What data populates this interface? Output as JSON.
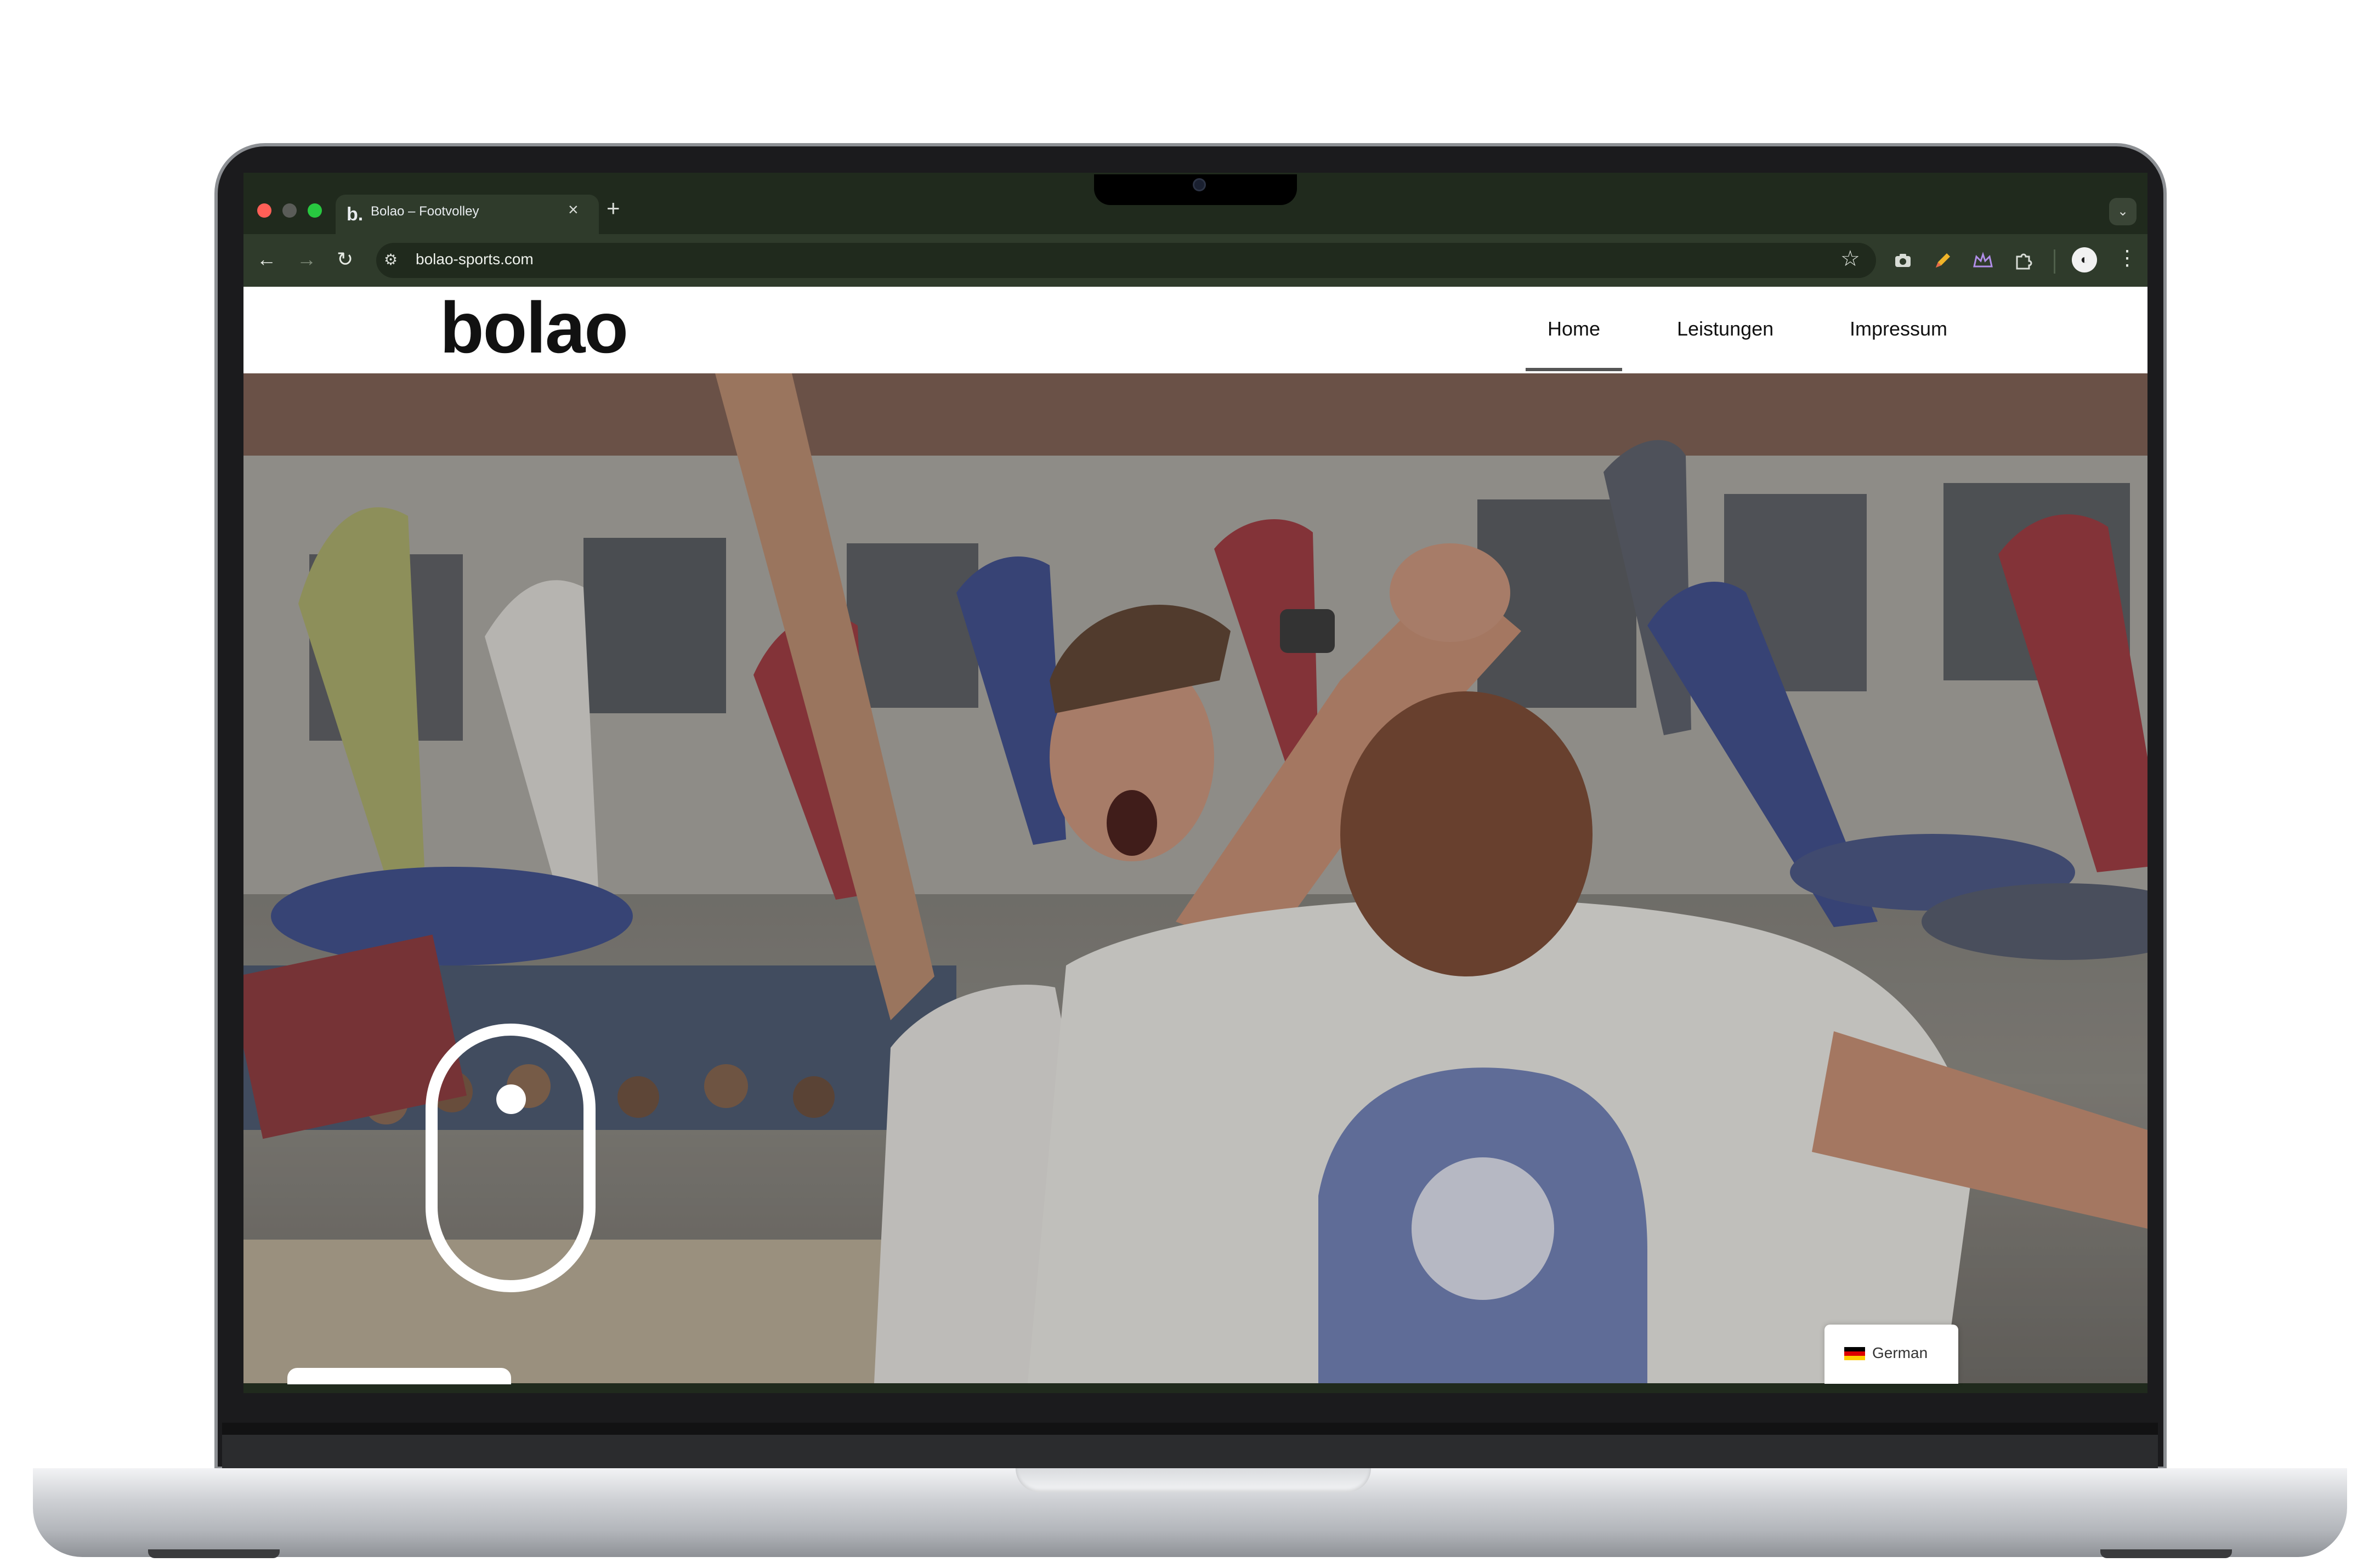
{
  "browser": {
    "tab": {
      "favicon": "b.",
      "title": "Bolao – Footvolley",
      "close_icon": "×"
    },
    "new_tab_icon": "+",
    "tab_list_icon": "⌄",
    "nav": {
      "back_icon": "←",
      "forward_icon": "→",
      "reload_icon": "↻"
    },
    "site_info_icon": "⚙",
    "url": "bolao-sports.com",
    "bookmark_icon": "☆",
    "extensions": [
      "camera-icon",
      "pen-icon",
      "crown-icon",
      "puzzle-icon"
    ],
    "profile_icon": "◐",
    "menu_icon": "⋮"
  },
  "site": {
    "logo": "bolao",
    "nav": [
      {
        "label": "Home",
        "active": true
      },
      {
        "label": "Leistungen"
      },
      {
        "label": "Impressum"
      }
    ],
    "language": {
      "label": "German",
      "flag_colors": [
        "#000000",
        "#dd0000",
        "#ffce00"
      ]
    }
  },
  "colors": {
    "browser_frame": "#202a1d",
    "toolbar": "#2f3b2b",
    "accent": "#111111"
  }
}
